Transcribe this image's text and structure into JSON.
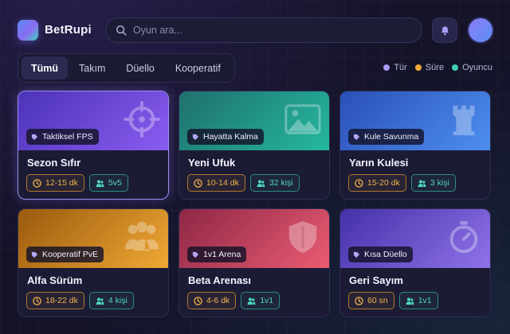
{
  "header": {
    "brand": "BetRupi",
    "search_placeholder": "Oyun ara..."
  },
  "tabs": [
    {
      "label": "Tümü",
      "active": true
    },
    {
      "label": "Takım",
      "active": false
    },
    {
      "label": "Düello",
      "active": false
    },
    {
      "label": "Kooperatif",
      "active": false
    }
  ],
  "legend": [
    {
      "label": "Tür",
      "color": "#a99af5"
    },
    {
      "label": "Süre",
      "color": "#f2a93b"
    },
    {
      "label": "Oyuncu",
      "color": "#3fd2b5"
    }
  ],
  "cards": [
    {
      "genre": "Taktiksel FPS",
      "title": "Sezon Sıfır",
      "duration": "12-15 dk",
      "players": "5v5",
      "icon": "crosshair-icon",
      "gradient": [
        "#4c33b8",
        "#8a5cf0"
      ],
      "featured": true
    },
    {
      "genre": "Hayatta Kalma",
      "title": "Yeni Ufuk",
      "duration": "10-14 dk",
      "players": "32 kişi",
      "icon": "mountain-image-icon",
      "gradient": [
        "#1f6f6e",
        "#25b8a0"
      ],
      "featured": false
    },
    {
      "genre": "Kule Savunma",
      "title": "Yarın Kulesi",
      "duration": "15-20 dk",
      "players": "3 kişi",
      "icon": "castle-tower-icon",
      "gradient": [
        "#2a4fb8",
        "#4d8ff0"
      ],
      "featured": false
    },
    {
      "genre": "Kooperatif PvE",
      "title": "Alfa Sürüm",
      "duration": "18-22 dk",
      "players": "4 kişi",
      "icon": "group-people-icon",
      "gradient": [
        "#9a5a0e",
        "#f0a834"
      ],
      "featured": false
    },
    {
      "genre": "1v1 Arena",
      "title": "Beta Arenası",
      "duration": "4-6 dk",
      "players": "1v1",
      "icon": "shield-icon",
      "gradient": [
        "#8e2746",
        "#ea5c72"
      ],
      "featured": false
    },
    {
      "genre": "Kısa Düello",
      "title": "Geri Sayım",
      "duration": "60 sn",
      "players": "1v1",
      "icon": "stopwatch-icon",
      "gradient": [
        "#4631a8",
        "#8f72ea"
      ],
      "featured": false
    }
  ]
}
